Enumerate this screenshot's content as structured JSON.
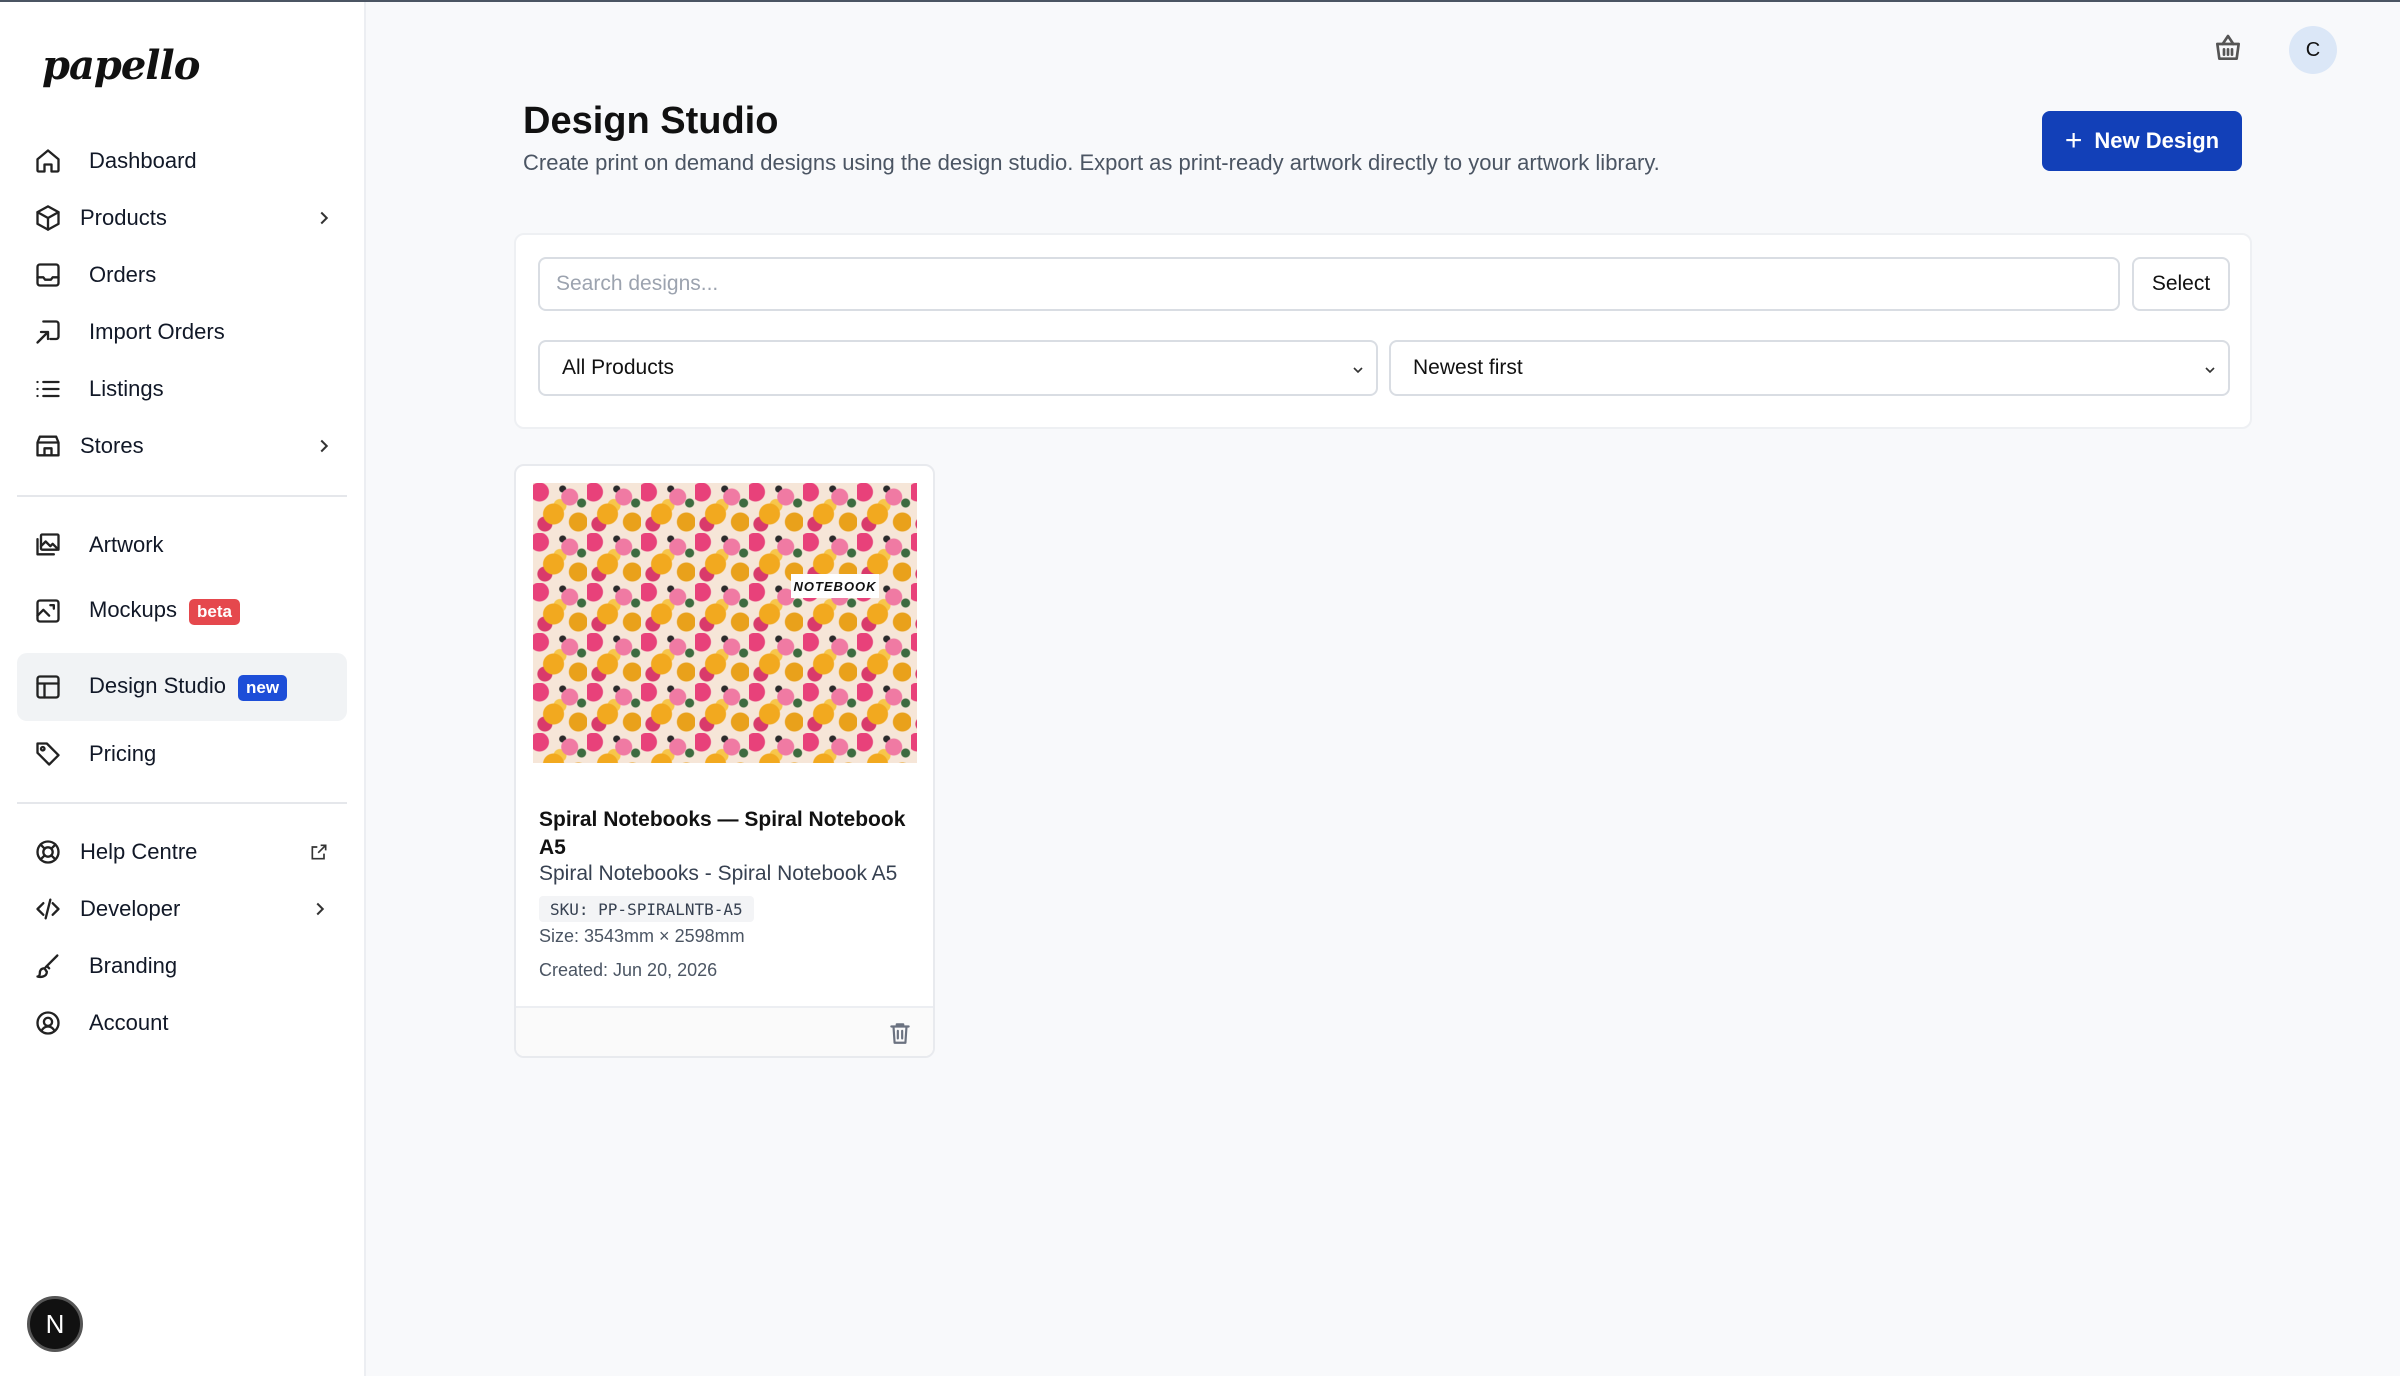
{
  "app": {
    "logo_text": "papello"
  },
  "sidebar": {
    "items": [
      {
        "label": "Dashboard",
        "icon": "home-icon"
      },
      {
        "label": "Products",
        "icon": "box-icon"
      },
      {
        "label": "Orders",
        "icon": "inbox-icon"
      },
      {
        "label": "Import Orders",
        "icon": "import-icon"
      },
      {
        "label": "Listings",
        "icon": "list-icon"
      },
      {
        "label": "Stores",
        "icon": "store-icon"
      },
      {
        "label": "Artwork",
        "icon": "images-icon"
      },
      {
        "label": "Mockups",
        "icon": "image-frame-icon",
        "badge": "beta"
      },
      {
        "label": "Design Studio",
        "icon": "layout-icon",
        "badge": "new"
      },
      {
        "label": "Pricing",
        "icon": "tag-icon"
      },
      {
        "label": "Help Centre",
        "icon": "lifebuoy-icon"
      },
      {
        "label": "Developer",
        "icon": "code-icon"
      },
      {
        "label": "Branding",
        "icon": "brush-icon"
      },
      {
        "label": "Account",
        "icon": "user-circle-icon"
      }
    ],
    "bottom_button": "N"
  },
  "topbar": {
    "avatar_initial": "C",
    "cart_icon": "basket-icon"
  },
  "header": {
    "title": "Design Studio",
    "subtitle": "Create print on demand designs using the design studio. Export as print-ready artwork directly to your artwork library.",
    "new_design_label": "New Design"
  },
  "filters": {
    "search_placeholder": "Search designs...",
    "select_label": "Select",
    "product_filter": "All Products",
    "sort": "Newest first"
  },
  "designs": [
    {
      "thumbnail_text": "NOTEBOOK",
      "title": "Spiral Notebooks — Spiral Notebook A5",
      "subtitle": "Spiral Notebooks - Spiral Notebook A5",
      "sku": "SKU: PP-SPIRALNTB-A5",
      "size": "Size: 3543mm × 2598mm",
      "created": "Created: Jun 20, 2026"
    }
  ],
  "colors": {
    "primary": "#1240b8",
    "badge_beta": "#e5484d",
    "badge_new": "#1d4ed8",
    "avatar_bg": "#dbe7f7"
  }
}
